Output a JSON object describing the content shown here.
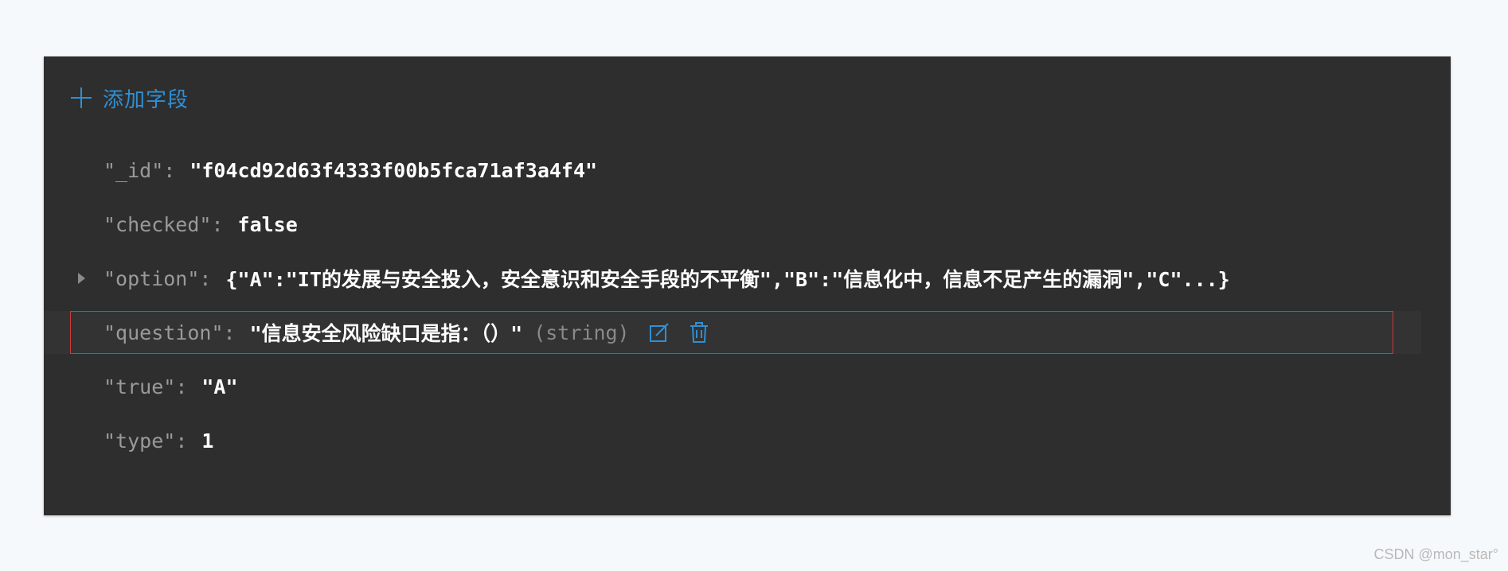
{
  "toolbar": {
    "add_field_label": "添加字段"
  },
  "document": {
    "fields": [
      {
        "key": "\"_id\"",
        "value": "\"f04cd92d63f4333f00b5fca71af3a4f4\"",
        "type_hint": "",
        "expandable": false,
        "selected": false
      },
      {
        "key": "\"checked\"",
        "value": "false",
        "type_hint": "",
        "expandable": false,
        "selected": false
      },
      {
        "key": "\"option\"",
        "value": "{\"A\":\"IT的发展与安全投入，安全意识和安全手段的不平衡\",\"B\":\"信息化中，信息不足产生的漏洞\",\"C\"...}",
        "type_hint": "",
        "expandable": true,
        "selected": false
      },
      {
        "key": "\"question\"",
        "value": "\"信息安全风险缺口是指：（）\"",
        "type_hint": "(string)",
        "expandable": false,
        "selected": true
      },
      {
        "key": "\"true\"",
        "value": "\"A\"",
        "type_hint": "",
        "expandable": false,
        "selected": false
      },
      {
        "key": "\"type\"",
        "value": "1",
        "type_hint": "",
        "expandable": false,
        "selected": false
      }
    ],
    "colon": ":"
  },
  "icons": {
    "edit": "edit-icon",
    "delete": "trash-icon",
    "expand": "caret-right-icon",
    "add": "plus-icon"
  },
  "colors": {
    "accent": "#2f8fd4",
    "panel_bg": "#2e2e2e",
    "selection_border": "#d03a3a"
  },
  "watermark": "CSDN @mon_star°"
}
